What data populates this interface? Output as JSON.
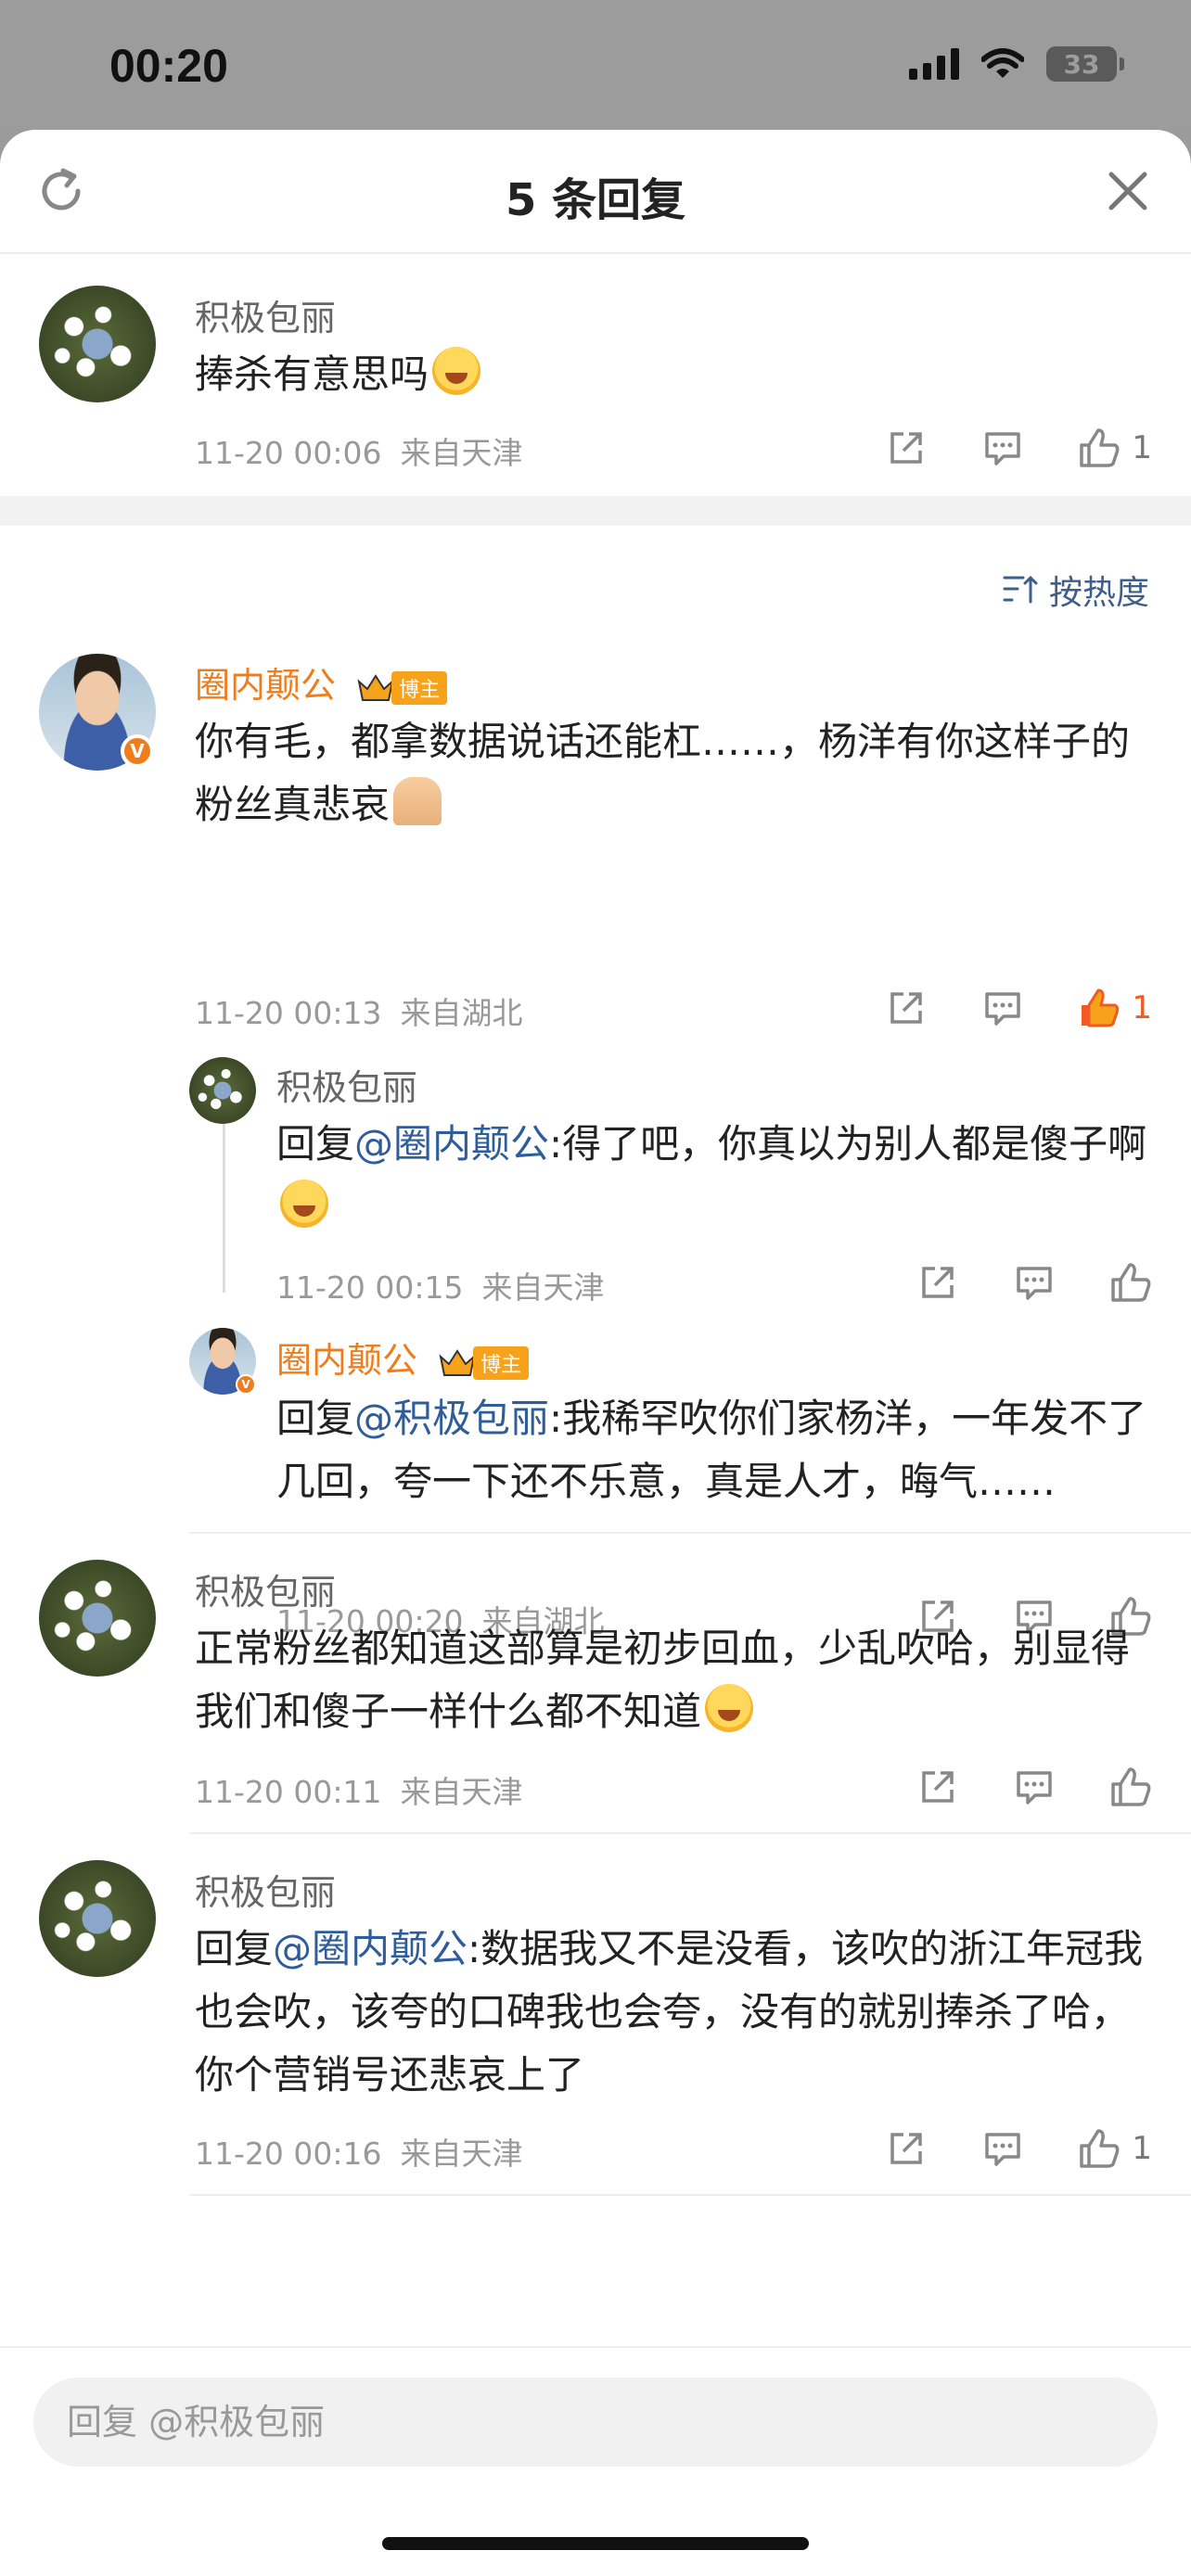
{
  "status": {
    "time": "00:20",
    "battery": "33"
  },
  "header": {
    "title": "5 条回复"
  },
  "sort_label": "按热度",
  "top_comment": {
    "user": "积极包丽",
    "text": "捧杀有意思吗",
    "time": "11-20 00:06",
    "location": "来自天津",
    "likes": "1"
  },
  "comments": [
    {
      "user": "圈内颠公",
      "badge": "博主",
      "text": "你有毛，都拿数据说话还能杠……，杨洋有你这样子的粉丝真悲哀",
      "time": "11-20 00:13",
      "location": "来自湖北",
      "likes": "1",
      "replies": [
        {
          "user": "积极包丽",
          "prefix": "回复",
          "mention": "@圈内颠公",
          "text": ":得了吧，你真以为别人都是傻子啊",
          "time": "11-20 00:15",
          "location": "来自天津"
        },
        {
          "user": "圈内颠公",
          "badge": "博主",
          "prefix": "回复",
          "mention": "@积极包丽",
          "text": ":我稀罕吹你们家杨洋，一年发不了几回，夸一下还不乐意，真是人才，晦气……",
          "time": "11-20 00:20",
          "location": "来自湖北"
        }
      ]
    },
    {
      "user": "积极包丽",
      "text": "正常粉丝都知道这部算是初步回血，少乱吹哈，别显得我们和傻子一样什么都不知道",
      "time": "11-20 00:11",
      "location": "来自天津"
    },
    {
      "user": "积极包丽",
      "prefix": "回复",
      "mention": "@圈内颠公",
      "text": ":数据我又不是没看，该吹的浙江年冠我也会吹，该夸的口碑我也会夸，没有的就别捧杀了哈，你个营销号还悲哀上了",
      "time": "11-20 00:16",
      "location": "来自天津",
      "likes": "1"
    }
  ],
  "reply_box": {
    "placeholder": "回复 @积极包丽"
  },
  "colors": {
    "accent_orange": "#f07d1c",
    "mention_blue": "#2f5d9a",
    "like_active": "#f05b22"
  }
}
